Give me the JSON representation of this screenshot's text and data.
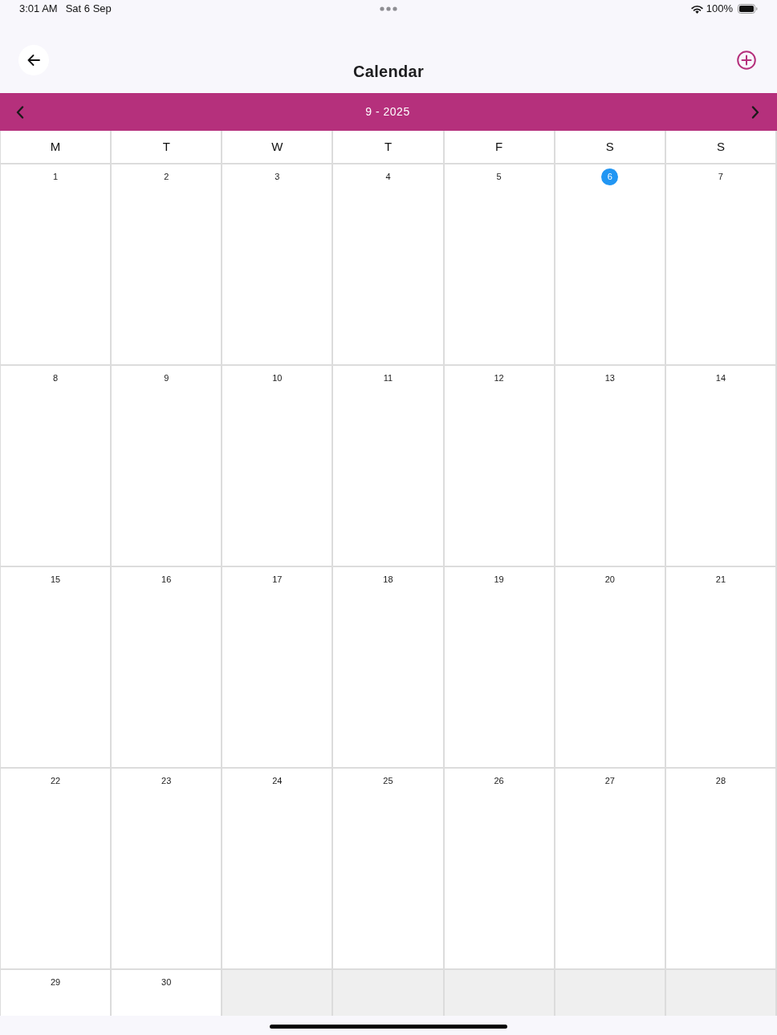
{
  "status_bar": {
    "time": "3:01 AM",
    "date": "Sat 6 Sep",
    "battery": "100%"
  },
  "header": {
    "title": "Calendar"
  },
  "month_bar": {
    "label": "9 - 2025"
  },
  "weekdays": [
    "M",
    "T",
    "W",
    "T",
    "F",
    "S",
    "S"
  ],
  "weeks": [
    [
      {
        "kind": "day",
        "day": "1",
        "today": false
      },
      {
        "kind": "day",
        "day": "2",
        "today": false
      },
      {
        "kind": "day",
        "day": "3",
        "today": false
      },
      {
        "kind": "day",
        "day": "4",
        "today": false
      },
      {
        "kind": "day",
        "day": "5",
        "today": false
      },
      {
        "kind": "day",
        "day": "6",
        "today": true
      },
      {
        "kind": "day",
        "day": "7",
        "today": false
      }
    ],
    [
      {
        "kind": "day",
        "day": "8",
        "today": false
      },
      {
        "kind": "day",
        "day": "9",
        "today": false
      },
      {
        "kind": "day",
        "day": "10",
        "today": false
      },
      {
        "kind": "day",
        "day": "11",
        "today": false
      },
      {
        "kind": "day",
        "day": "12",
        "today": false
      },
      {
        "kind": "day",
        "day": "13",
        "today": false
      },
      {
        "kind": "day",
        "day": "14",
        "today": false
      }
    ],
    [
      {
        "kind": "day",
        "day": "15",
        "today": false
      },
      {
        "kind": "day",
        "day": "16",
        "today": false
      },
      {
        "kind": "day",
        "day": "17",
        "today": false
      },
      {
        "kind": "day",
        "day": "18",
        "today": false
      },
      {
        "kind": "day",
        "day": "19",
        "today": false
      },
      {
        "kind": "day",
        "day": "20",
        "today": false
      },
      {
        "kind": "day",
        "day": "21",
        "today": false
      }
    ],
    [
      {
        "kind": "day",
        "day": "22",
        "today": false
      },
      {
        "kind": "day",
        "day": "23",
        "today": false
      },
      {
        "kind": "day",
        "day": "24",
        "today": false
      },
      {
        "kind": "day",
        "day": "25",
        "today": false
      },
      {
        "kind": "day",
        "day": "26",
        "today": false
      },
      {
        "kind": "day",
        "day": "27",
        "today": false
      },
      {
        "kind": "day",
        "day": "28",
        "today": false
      }
    ],
    [
      {
        "kind": "day",
        "day": "29",
        "today": false
      },
      {
        "kind": "day",
        "day": "30",
        "today": false
      },
      {
        "kind": "empty"
      },
      {
        "kind": "empty"
      },
      {
        "kind": "empty"
      },
      {
        "kind": "empty"
      },
      {
        "kind": "empty"
      }
    ]
  ]
}
